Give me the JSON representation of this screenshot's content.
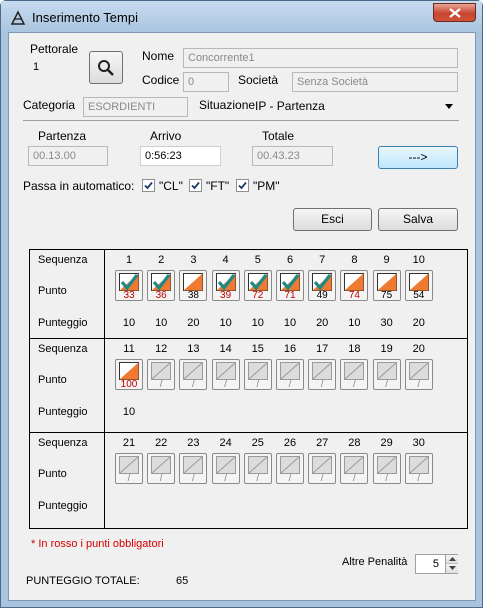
{
  "window": {
    "title": "Inserimento Tempi"
  },
  "form": {
    "pettorale_label": "Pettorale",
    "pettorale_value": "1",
    "nome_label": "Nome",
    "nome_value": "Concorrente1",
    "codice_label": "Codice",
    "codice_value": "0",
    "societa_label": "Società",
    "societa_value": "Senza Società",
    "categoria_label": "Categoria",
    "categoria_value": "ESORDIENTI",
    "situazione_label": "Situazione",
    "situazione_value": "IP - Partenza"
  },
  "times": {
    "partenza_label": "Partenza",
    "partenza_value": "00.13.00",
    "arrivo_label": "Arrivo",
    "arrivo_value": "0:56:23",
    "totale_label": "Totale",
    "totale_value": "00.43.23",
    "arrow_button": "--->"
  },
  "auto": {
    "label": "Passa in automatico:",
    "options": [
      "\"CL\"",
      "\"FT\"",
      "\"PM\""
    ]
  },
  "buttons": {
    "esci": "Esci",
    "salva": "Salva"
  },
  "grid": {
    "row_labels": {
      "sequenza": "Sequenza",
      "punto": "Punto",
      "punteggio": "Punteggio"
    },
    "sections": [
      {
        "seq": [
          "1",
          "2",
          "3",
          "4",
          "5",
          "6",
          "7",
          "8",
          "9",
          "10"
        ],
        "points": [
          {
            "code": "33",
            "state": "checked",
            "mandatory": true
          },
          {
            "code": "36",
            "state": "checked",
            "mandatory": true
          },
          {
            "code": "38",
            "state": "flag",
            "mandatory": false
          },
          {
            "code": "39",
            "state": "checked",
            "mandatory": true
          },
          {
            "code": "72",
            "state": "checked",
            "mandatory": true
          },
          {
            "code": "71",
            "state": "checked",
            "mandatory": true
          },
          {
            "code": "49",
            "state": "checked",
            "mandatory": false
          },
          {
            "code": "74",
            "state": "flag",
            "mandatory": true
          },
          {
            "code": "75",
            "state": "flag",
            "mandatory": false
          },
          {
            "code": "54",
            "state": "flag",
            "mandatory": false
          }
        ],
        "scores": [
          "10",
          "10",
          "20",
          "10",
          "10",
          "10",
          "20",
          "10",
          "30",
          "20"
        ]
      },
      {
        "seq": [
          "11",
          "12",
          "13",
          "14",
          "15",
          "16",
          "17",
          "18",
          "19",
          "20"
        ],
        "points": [
          {
            "code": "100",
            "state": "flag",
            "mandatory": true
          },
          {
            "code": "/",
            "state": "empty",
            "mandatory": false
          },
          {
            "code": "/",
            "state": "empty",
            "mandatory": false
          },
          {
            "code": "/",
            "state": "empty",
            "mandatory": false
          },
          {
            "code": "/",
            "state": "empty",
            "mandatory": false
          },
          {
            "code": "/",
            "state": "empty",
            "mandatory": false
          },
          {
            "code": "/",
            "state": "empty",
            "mandatory": false
          },
          {
            "code": "/",
            "state": "empty",
            "mandatory": false
          },
          {
            "code": "/",
            "state": "empty",
            "mandatory": false
          },
          {
            "code": "/",
            "state": "empty",
            "mandatory": false
          }
        ],
        "scores": [
          "10",
          "",
          "",
          "",
          "",
          "",
          "",
          "",
          "",
          ""
        ]
      },
      {
        "seq": [
          "21",
          "22",
          "23",
          "24",
          "25",
          "26",
          "27",
          "28",
          "29",
          "30"
        ],
        "points": [
          {
            "code": "/",
            "state": "empty",
            "mandatory": false
          },
          {
            "code": "/",
            "state": "empty",
            "mandatory": false
          },
          {
            "code": "/",
            "state": "empty",
            "mandatory": false
          },
          {
            "code": "/",
            "state": "empty",
            "mandatory": false
          },
          {
            "code": "/",
            "state": "empty",
            "mandatory": false
          },
          {
            "code": "/",
            "state": "empty",
            "mandatory": false
          },
          {
            "code": "/",
            "state": "empty",
            "mandatory": false
          },
          {
            "code": "/",
            "state": "empty",
            "mandatory": false
          },
          {
            "code": "/",
            "state": "empty",
            "mandatory": false
          },
          {
            "code": "/",
            "state": "empty",
            "mandatory": false
          }
        ],
        "scores": [
          "",
          "",
          "",
          "",
          "",
          "",
          "",
          "",
          "",
          ""
        ]
      }
    ]
  },
  "note": "* In rosso i punti obbligatori",
  "penalita": {
    "label": "Altre Penalità",
    "value": "5"
  },
  "totale": {
    "label": "PUNTEGGIO TOTALE:",
    "value": "65"
  },
  "colors": {
    "mandatory": "#c00000",
    "flag_orange": "#f07a30",
    "check_teal": "#1a8a8a"
  }
}
